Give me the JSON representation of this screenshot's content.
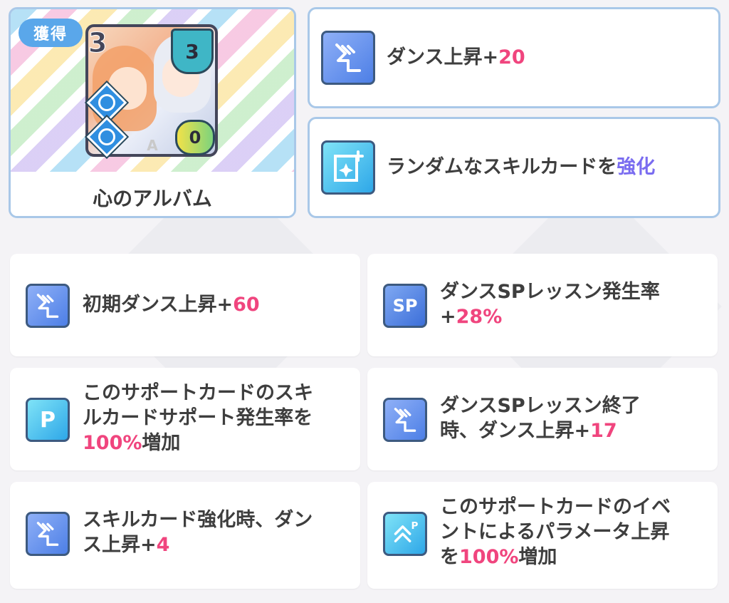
{
  "card": {
    "badge": "獲得",
    "cost": "3",
    "shield_value": "3",
    "heart_value": "0",
    "rarity_letter": "A",
    "name": "心のアルバム"
  },
  "top_stats": [
    {
      "icon": "dance-boost-icon",
      "text": "ダンス上昇+",
      "value": "20"
    },
    {
      "icon": "skill-card-enhance-icon",
      "text": "ランダムなスキルカードを",
      "value": "強化"
    }
  ],
  "abilities": [
    {
      "icon": "dance-boost-icon",
      "line1": "初期ダンス上昇+",
      "value": "60"
    },
    {
      "icon": "sp-icon",
      "icon_text": "SP",
      "line1": "ダンスSPレッスン発生率",
      "line2_prefix": "+",
      "value": "28%"
    },
    {
      "icon": "support-p-icon",
      "icon_text": "P",
      "line1": "このサポートカードのスキ",
      "line2": "ルカードサポート発生率を",
      "value": "100%",
      "suffix": "増加"
    },
    {
      "icon": "dance-boost-icon",
      "line1": "ダンスSPレッスン終了",
      "line2": "時、ダンス上昇+",
      "value": "17"
    },
    {
      "icon": "dance-boost-icon",
      "line1": "スキルカード強化時、ダン",
      "line2": "ス上昇+",
      "value": "4"
    },
    {
      "icon": "event-param-icon",
      "icon_text": "P",
      "line1": "このサポートカードのイベ",
      "line2": "ントによるパラメータ上昇",
      "line3_prefix": "を",
      "value": "100%",
      "suffix": "増加"
    }
  ],
  "colors": {
    "accent_pink": "#f0457e",
    "accent_purple": "#7a6cf0",
    "border_blue": "#a9c8e8",
    "badge_blue": "#5aa7ea"
  }
}
